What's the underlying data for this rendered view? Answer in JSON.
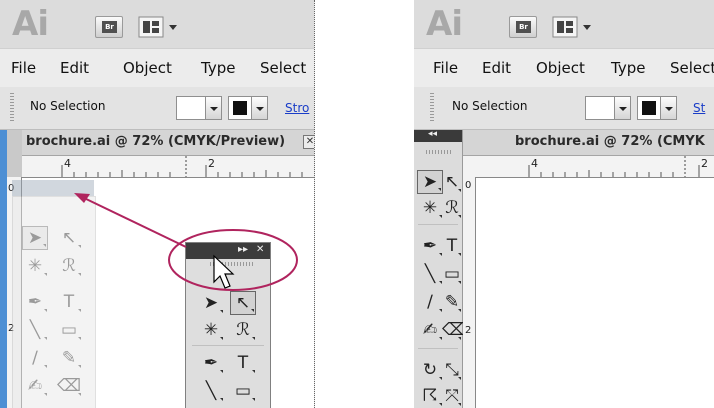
{
  "app": {
    "logo": "Ai",
    "bridge_label": "Br"
  },
  "menu": [
    "File",
    "Edit",
    "Object",
    "Type",
    "Select"
  ],
  "control_bar": {
    "selection_label": "No Selection",
    "stroke_link_left": "Stro",
    "stroke_link_right": "St"
  },
  "document": {
    "tab_title": "brochure.ai @ 72% (CMYK/Preview)",
    "tab_title_truncated": "brochure.ai @ 72% (CMYK"
  },
  "ruler": {
    "h_labels": [
      "4",
      "2"
    ],
    "v_labels": [
      "0",
      "2"
    ]
  },
  "panel_header": {
    "collapse_glyph": "▸▸",
    "close_glyph": "✕",
    "dock_collapse_glyph": "◂◂"
  },
  "tools": [
    {
      "name": "selection",
      "icon": "select-arrow-icon",
      "glyph": "➤"
    },
    {
      "name": "direct-selection",
      "icon": "direct-select-icon",
      "glyph": "↖"
    },
    {
      "name": "magic-wand",
      "icon": "magic-wand-icon",
      "glyph": "✳"
    },
    {
      "name": "lasso",
      "icon": "lasso-icon",
      "glyph": "ℛ"
    },
    {
      "name": "pen",
      "icon": "pen-icon",
      "glyph": "✒"
    },
    {
      "name": "type",
      "icon": "type-icon",
      "glyph": "T"
    },
    {
      "name": "line-segment",
      "icon": "line-icon",
      "glyph": "╲"
    },
    {
      "name": "rectangle",
      "icon": "rectangle-icon",
      "glyph": "▭"
    },
    {
      "name": "paintbrush",
      "icon": "brush-icon",
      "glyph": "∕"
    },
    {
      "name": "pencil",
      "icon": "pencil-icon",
      "glyph": "✎"
    },
    {
      "name": "blob-brush",
      "icon": "blob-brush-icon",
      "glyph": "✍"
    },
    {
      "name": "eraser",
      "icon": "eraser-icon",
      "glyph": "⌫"
    },
    {
      "name": "rotate",
      "icon": "rotate-icon",
      "glyph": "↻"
    },
    {
      "name": "scale",
      "icon": "scale-icon",
      "glyph": "⤡"
    },
    {
      "name": "warp",
      "icon": "warp-icon",
      "glyph": "☈"
    },
    {
      "name": "free-transform",
      "icon": "free-transform-icon",
      "glyph": "⤧"
    }
  ],
  "colors": {
    "annotation": "#b0245e",
    "accent_blue": "#4d8fd4",
    "link_blue": "#1a3dc8"
  }
}
